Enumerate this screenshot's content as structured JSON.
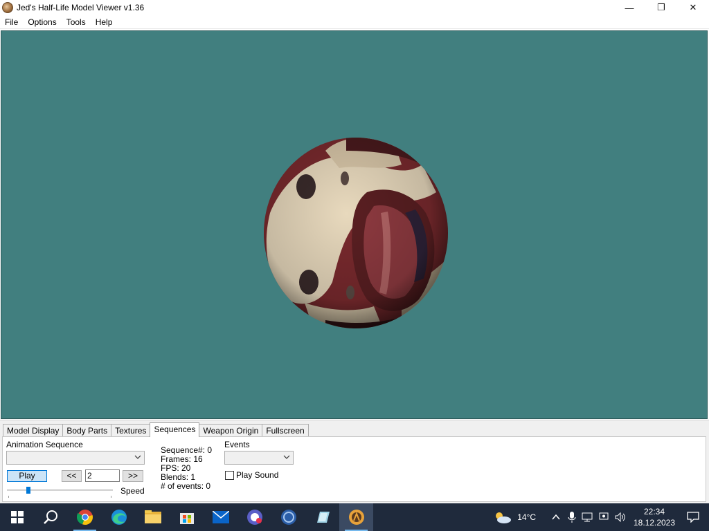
{
  "window": {
    "title": "Jed's Half-Life Model Viewer v1.36",
    "controls": {
      "minimize": "—",
      "maximize": "❐",
      "close": "✕"
    }
  },
  "menu": [
    "File",
    "Options",
    "Tools",
    "Help"
  ],
  "viewport": {
    "background": "#417f7f"
  },
  "tabs": [
    "Model Display",
    "Body Parts",
    "Textures",
    "Sequences",
    "Weapon Origin",
    "Fullscreen"
  ],
  "active_tab": "Sequences",
  "sequences": {
    "animation_label": "Animation Sequence",
    "animation_value": "",
    "play_label": "Play",
    "prev_label": "<<",
    "next_label": ">>",
    "frame_value": "2",
    "speed_label": "Speed",
    "speed_value": 0.2,
    "info": {
      "sequence": "Sequence#: 0",
      "frames": "Frames: 16",
      "fps": "FPS: 20",
      "blends": "Blends: 1",
      "events": "# of events: 0"
    },
    "events_label": "Events",
    "events_value": "",
    "play_sound_label": "Play Sound",
    "play_sound_checked": false
  },
  "taskbar": {
    "apps": [
      "windows-start",
      "search",
      "chrome",
      "edge",
      "file-explorer",
      "microsoft-store",
      "mail",
      "app-6",
      "app-7",
      "app-8",
      "half-life-model-viewer"
    ],
    "weather": "14°C",
    "time": "22:34",
    "date": "18.12.2023"
  }
}
